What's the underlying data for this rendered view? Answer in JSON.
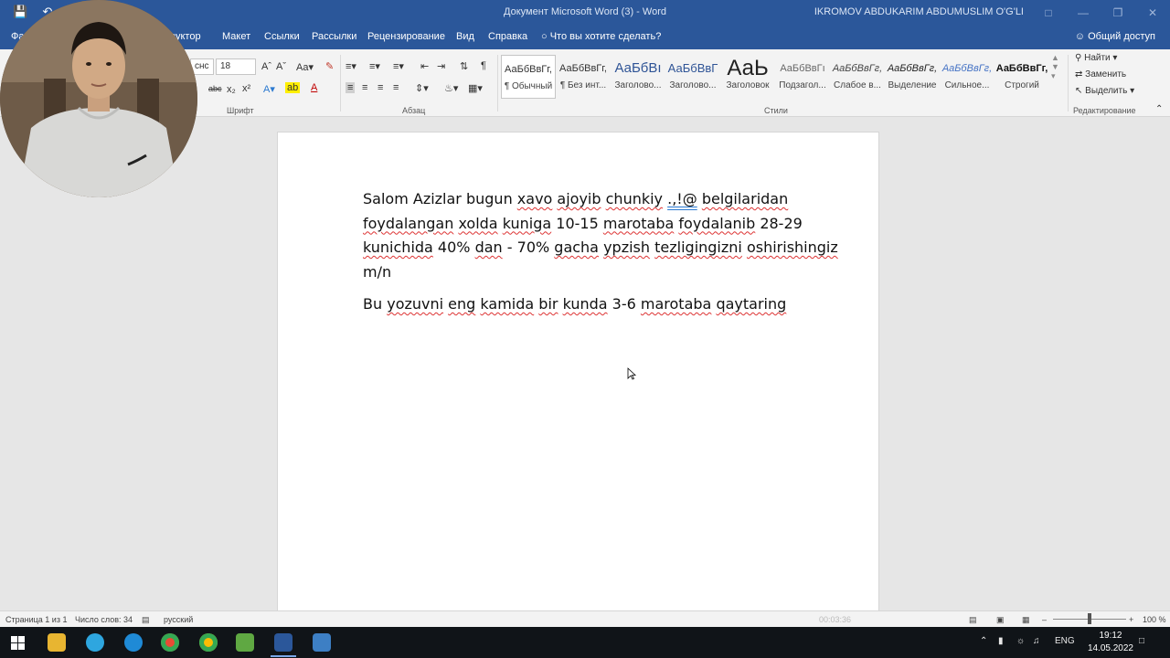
{
  "window": {
    "title": "Документ Microsoft Word (3)  -  Word",
    "user": "IKROMOV ABDUKARIM ABDUMUSLIM O'G'LI"
  },
  "tabs": {
    "file": "Фа",
    "design": "руктор",
    "layout": "Макет",
    "references": "Ссылки",
    "mailings": "Рассылки",
    "review": "Рецензирование",
    "view": "Вид",
    "help": "Справка",
    "tell_me": "Что вы хотите сделать?",
    "share": "Общий доступ"
  },
  "ribbon": {
    "font_name": "снс",
    "font_size": "18",
    "font_group": "Шрифт",
    "paragraph_group": "Абзац",
    "styles_group": "Стили",
    "editing_group": "Редактирование",
    "styles": [
      {
        "preview": "АаБбВвГг,",
        "name": "¶ Обычный"
      },
      {
        "preview": "АаБбВвГг,",
        "name": "¶ Без инт..."
      },
      {
        "preview": "АаБбВı",
        "name": "Заголово..."
      },
      {
        "preview": "АаБбВвГ",
        "name": "Заголово..."
      },
      {
        "preview": "АаЬ",
        "name": "Заголовок"
      },
      {
        "preview": "АаБбВвГı",
        "name": "Подзагол..."
      },
      {
        "preview": "АаБбВвГг,",
        "name": "Слабое в..."
      },
      {
        "preview": "АаБбВвГг,",
        "name": "Выделение"
      },
      {
        "preview": "АаБбВвГг,",
        "name": "Сильное..."
      },
      {
        "preview": "АаБбВвГг,",
        "name": "Строгий"
      }
    ],
    "find": "Найти",
    "replace": "Заменить",
    "select": "Выделить"
  },
  "document": {
    "p1": {
      "w1": "Salom Azizlar bugun",
      "w2": "xavo",
      "w3": " ",
      "w4": "ajoyib",
      "w5": " ",
      "w6": "chunkiy",
      "w7": " ",
      "w8": ".,!@",
      "w9": " ",
      "w10": "belgilaridan",
      "w11": " ",
      "w12": "foydalangan",
      "w13": " ",
      "w14": "xolda",
      "w15": " ",
      "w16": "kuniga",
      "w17": " 10-15 ",
      "w18": "marotaba",
      "w19": " ",
      "w20": "foydalanib",
      "w21": " 28-29 ",
      "w22": "kunichida",
      "w23": " 40% ",
      "w24": "dan",
      "w25": " - 70% ",
      "w26": "gacha",
      "w27": " ",
      "w28": "ypzish",
      "w29": " ",
      "w30": "tezligingizni",
      "w31": " ",
      "w32": "oshirishingiz",
      "w33": " m/n"
    },
    "p2": {
      "w1": "Bu",
      "w2": " ",
      "w3": "yozuvni",
      "w4": " ",
      "w5": "eng",
      "w6": " ",
      "w7": "kamida",
      "w8": " ",
      "w9": "bir",
      "w10": " ",
      "w11": "kunda",
      "w12": " 3-6 ",
      "w13": "marotaba",
      "w14": " ",
      "w15": "qaytaring"
    }
  },
  "status": {
    "page": "Страница 1 из 1",
    "words": "Число слов: 34",
    "lang": "русский",
    "timer": "00:03:36",
    "zoom": "100 %"
  },
  "taskbar": {
    "lang": "ENG",
    "time": "19:12",
    "date": "14.05.2022"
  },
  "colors": {
    "word_blue": "#2b579a",
    "ribbon_bg": "#f3f3f3",
    "taskbar": "#101418",
    "spell_squiggle": "#d33333"
  }
}
